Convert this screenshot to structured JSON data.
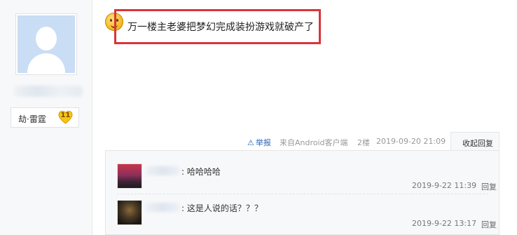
{
  "sidebar": {
    "badge_label": "劫·雷霆",
    "badge_level": "11"
  },
  "post": {
    "text": "万一楼主老婆把梦幻完成装扮游戏就破产了"
  },
  "meta": {
    "report": "举报",
    "from": "来自Android客户端",
    "floor": "2楼",
    "time": "2019-09-20 21:09",
    "collapse": "收起回复"
  },
  "replies": [
    {
      "text": ": 哈哈哈哈",
      "time": "2019-9-22 11:39",
      "reply": "回复"
    },
    {
      "text": ": 这是人说的话？？？",
      "time": "2019-9-22 13:17",
      "reply": "回复"
    }
  ],
  "colors": {
    "highlight_border": "#d9343a",
    "link_blue": "#2d64b3",
    "avatar_bg": "#c9ddf4",
    "level_badge": "#f5c518"
  }
}
